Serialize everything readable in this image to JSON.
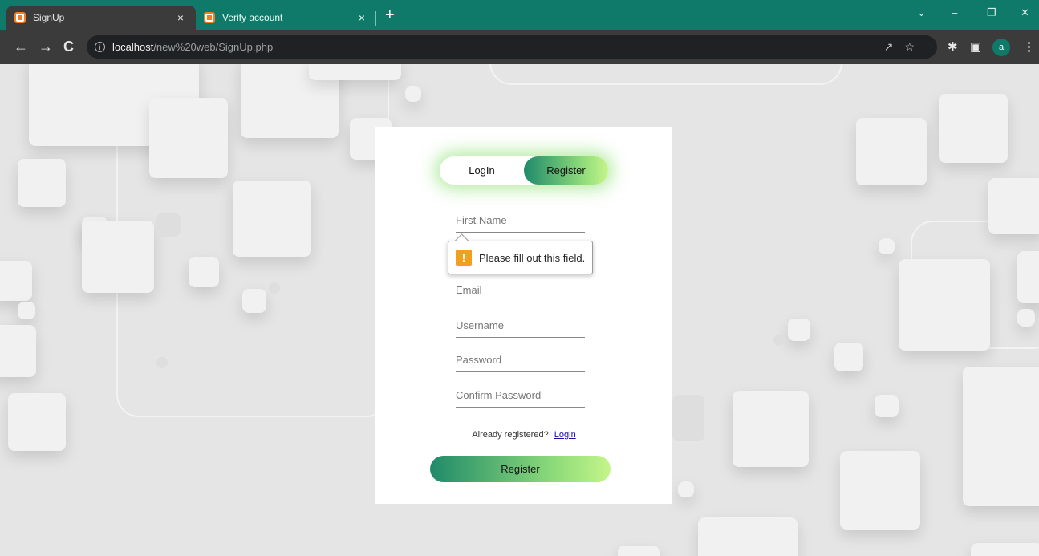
{
  "browser": {
    "tabs": [
      {
        "title": "SignUp",
        "active": true
      },
      {
        "title": "Verify account",
        "active": false
      }
    ],
    "new_tab_icon": "+",
    "close_icon": "×",
    "url_host": "localhost",
    "url_path": "/new%20web/SignUp.php",
    "profile_initial": "a",
    "colors": {
      "tabbar": "#0f7a6a",
      "toolbar": "#3b3b3b"
    }
  },
  "form": {
    "toggle": {
      "login_label": "LogIn",
      "register_label": "Register",
      "selected": "Register"
    },
    "fields": {
      "first_name_placeholder": "First Name",
      "email_placeholder": "Email",
      "username_placeholder": "Username",
      "password_placeholder": "Password",
      "confirm_password_placeholder": "Confirm Password"
    },
    "validation_message": "Please fill out this field.",
    "already_registered_text": "Already registered?",
    "login_link": "Login",
    "submit_label": "Register",
    "colors": {
      "gradient_start": "#1f8a6a",
      "gradient_end": "#c5f58a",
      "warning": "#f29f1a"
    }
  }
}
